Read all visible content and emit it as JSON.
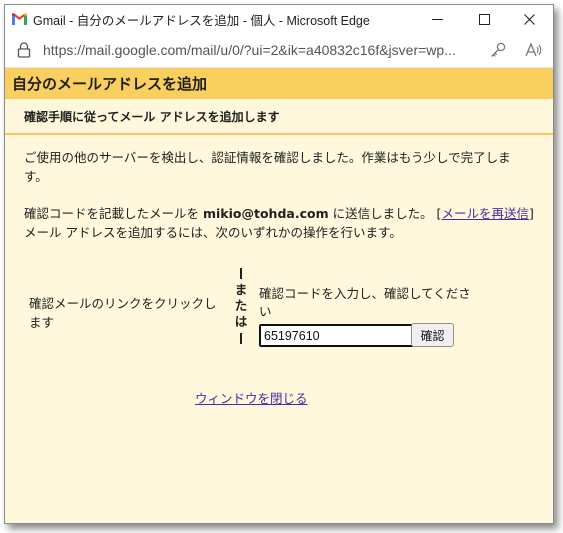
{
  "window": {
    "title": "Gmail - 自分のメールアドレスを追加 - 個人 - Microsoft Edge",
    "url": "https://mail.google.com/mail/u/0/?ui=2&ik=a40832c16f&jsver=wp..."
  },
  "dialog": {
    "header": "自分のメールアドレスを追加",
    "subheader": "確認手順に従ってメール アドレスを追加します",
    "intro_line1": "ご使用の他のサーバーを検出し、認証情報を確認しました。作業はもう少しで完了しま",
    "intro_line2": "す。",
    "sent_prefix": "確認コードを記載したメールを ",
    "sent_email": "mikio@tohda.com",
    "sent_suffix": " に送信しました。 [",
    "resend_link": "メールを再送信",
    "sent_bracket_close": "]",
    "instruction": "メール アドレスを追加するには、次のいずれかの操作を行います。",
    "option_click_line1": "確認メールのリンクをクリックし",
    "option_click_line2": "ます",
    "or_chars": [
      "ま",
      "た",
      "は"
    ],
    "option_code_line1": "確認コードを入力し、確認してくださ",
    "option_code_line2": "い",
    "code_value": "65197610",
    "confirm_button": "確認",
    "close_link": "ウィンドウを閉じる"
  },
  "colors": {
    "header_bg": "#f9cf5f",
    "body_bg": "#fff8dc",
    "link": "#4a2aa0"
  }
}
